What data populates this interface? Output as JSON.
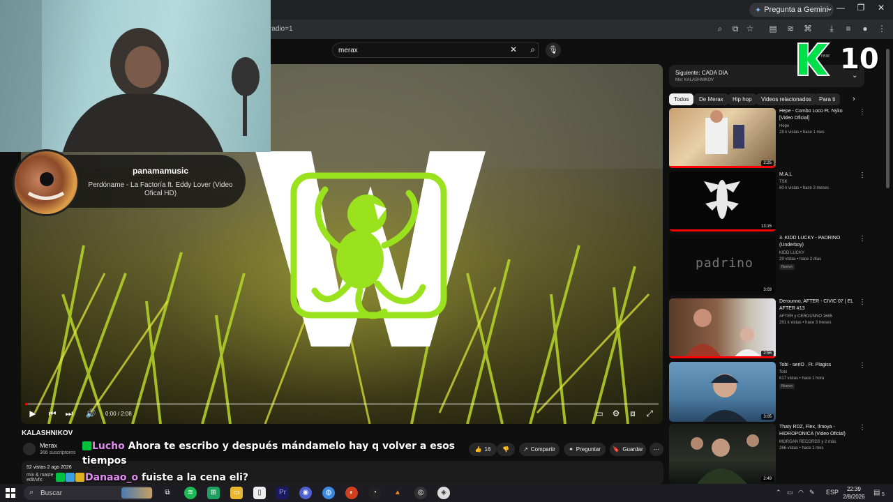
{
  "browser": {
    "gemini_label": "Pregunta a Gemini",
    "url": "radio=1"
  },
  "search": {
    "value": "merax",
    "placeholder": "Buscar"
  },
  "player": {
    "time": "0:00 / 2:08",
    "progress": 0.0
  },
  "music_card": {
    "artist": "panamamusic",
    "track": "Perdóname - La Factoría ft. Eddy Lover (Video Ofical HD)"
  },
  "video": {
    "title": "KALASHNIKOV",
    "channel": "Merax",
    "subscribers": "366 suscriptores",
    "likes": "16",
    "share_label": "Compartir",
    "ask_label": "Preguntar",
    "save_label": "Guardar",
    "stats": "52 vistas  2 ago 2026",
    "desc_line1": "mix & maste",
    "desc_line2": "edit/vfx:"
  },
  "chat": [
    {
      "user": "Lucho",
      "message": "Ahora te escribo y después mándamelo hay q volver a esos tiempos"
    },
    {
      "user": "Danaao_o",
      "message": "fuiste a la cena eli?"
    }
  ],
  "sidebar": {
    "up_next_title": "Siguiente: CADA DIA",
    "up_next_sub": "Mix: KALASHNIKOV",
    "overlay_partial": "rear",
    "k10_label": "10",
    "chips": [
      "Todos",
      "De Merax",
      "Hip hop",
      "Videos relacionados",
      "Para ti"
    ],
    "recommendations": [
      {
        "title": "Hepe - Combo Loco Ft. Nyko [Video Oficial]",
        "channel": "Hepe",
        "meta": "28 k vistas • hace 1 mes",
        "duration": "2:25",
        "watched": true,
        "new": ""
      },
      {
        "title": "M.A.L",
        "channel": "TSK",
        "meta": "60 k vistas • hace 3 meses",
        "duration": "13:15",
        "watched": true,
        "new": ""
      },
      {
        "title": "3. KIDD LUCKY - PADRINO (Underboy)",
        "channel": "KIDD LUCKY",
        "meta": "29 vistas • hace 2 días",
        "duration": "3:03",
        "watched": false,
        "new": "Nuevo",
        "thumb_text": "padrino"
      },
      {
        "title": "Derounno, AFTER - CIVIC 07 | EL AFTER #13",
        "channel": "AFTER y CEROUNNO 1665",
        "meta": "291 k vistas • hace 3 meses",
        "duration": "2:56",
        "watched": true,
        "new": ""
      },
      {
        "title": "Tobi - seriO . Ft. Plagiss",
        "channel": "Tobi",
        "meta": "617 vistas • hace 1 hora",
        "duration": "3:05",
        "watched": false,
        "new": "Nuevo"
      },
      {
        "title": "Thaty RDZ, Flex, Ilmoya - HIDROPONICA (Video Oficial)",
        "channel": "MORGAN RECORDS y 2 más",
        "meta": "266 vistas • hace 1 mes",
        "duration": "2:49",
        "watched": false,
        "new": ""
      }
    ]
  },
  "taskbar": {
    "search_label": "Buscar",
    "lang": "ESP",
    "time": "22:39",
    "date": "2/8/2026",
    "notif_count": "5"
  },
  "colors": {
    "accent_red": "#ff0000",
    "lime": "#9be21e",
    "k10_green": "#00e04a"
  }
}
